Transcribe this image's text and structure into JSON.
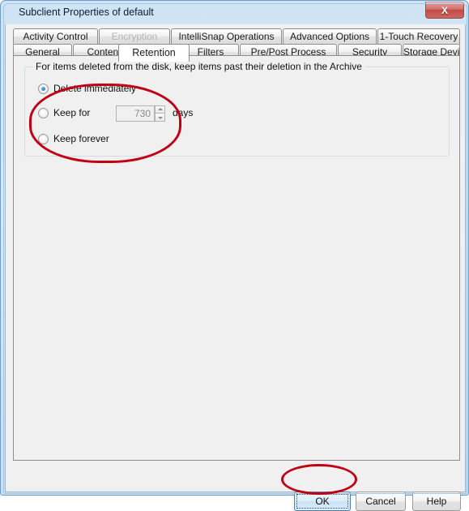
{
  "window": {
    "title": "Subclient Properties of default",
    "close_icon": "close-x-icon",
    "close_label": "X"
  },
  "tabs": {
    "row1": [
      {
        "label": "Activity Control",
        "state": "enabled"
      },
      {
        "label": "Encryption",
        "state": "disabled"
      },
      {
        "label": "IntelliSnap Operations",
        "state": "enabled"
      },
      {
        "label": "Advanced Options",
        "state": "enabled"
      },
      {
        "label": "1-Touch Recovery",
        "state": "enabled"
      }
    ],
    "row2": [
      {
        "label": "General",
        "state": "enabled"
      },
      {
        "label": "Content",
        "state": "enabled"
      },
      {
        "label": "Retention",
        "state": "active"
      },
      {
        "label": "Filters",
        "state": "enabled"
      },
      {
        "label": "Pre/Post Process",
        "state": "enabled"
      },
      {
        "label": "Security",
        "state": "enabled"
      },
      {
        "label": "Storage Device",
        "state": "enabled"
      }
    ]
  },
  "retention": {
    "group_label": "For items deleted from the disk,  keep items past their deletion in the Archive",
    "options": [
      {
        "label": "Delete immediately",
        "selected": true
      },
      {
        "label": "Keep for",
        "selected": false
      },
      {
        "label": "Keep forever",
        "selected": false
      }
    ],
    "days_value": "730",
    "days_unit": "days",
    "spinner_up_icon": "spinner-up-arrow-icon",
    "spinner_down_icon": "spinner-down-arrow-icon"
  },
  "footer": {
    "ok": "OK",
    "cancel": "Cancel",
    "help": "Help"
  },
  "annotations": {
    "highlight_color": "#c00014",
    "retention_options_ellipse": "retention-options-highlight",
    "ok_button_ellipse": "ok-button-highlight"
  }
}
